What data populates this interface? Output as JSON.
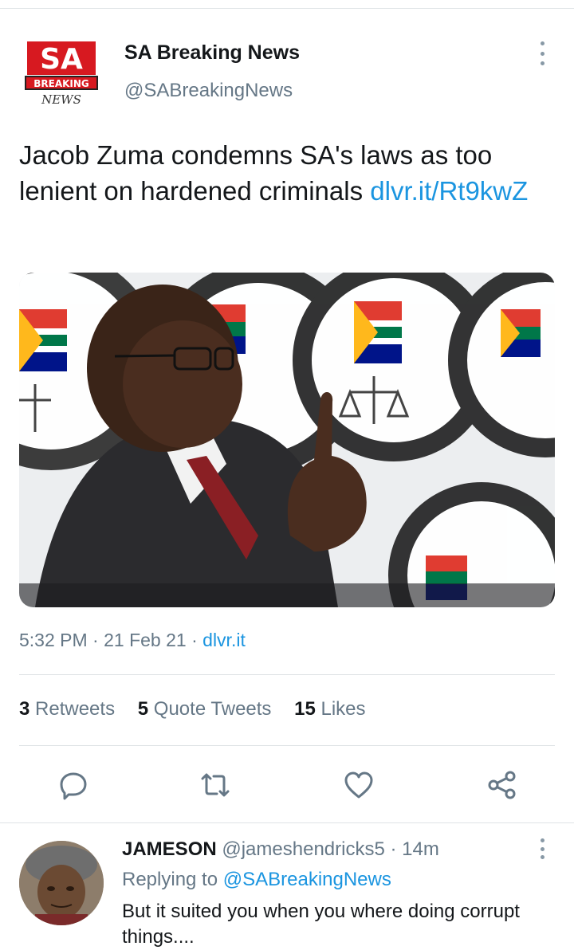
{
  "tweet": {
    "author_name": "SA Breaking News",
    "author_handle": "@SABreakingNews",
    "logo_text_top": "SA",
    "logo_text_mid": "BREAKING",
    "logo_text_bottom": "NEWS",
    "text": "Jacob Zuma condemns SA's laws as too lenient on hardened criminals ",
    "link": "dlvr.it/Rt9kwZ",
    "time": "5:32 PM",
    "date": "21 Feb 21",
    "source": "dlvr.it",
    "retweets_count": "3",
    "retweets_label": "Retweets",
    "quotes_count": "5",
    "quotes_label": "Quote Tweets",
    "likes_count": "15",
    "likes_label": "Likes"
  },
  "actions": [
    "reply-icon",
    "retweet-icon",
    "like-icon",
    "share-icon"
  ],
  "reply": {
    "author_name": "JAMESON",
    "author_handle": "@jameshendricks5",
    "time": "14m",
    "replying_prefix": "Replying to ",
    "replying_to": "@SABreakingNews",
    "text": "But it suited you when you where doing corrupt things...."
  },
  "colors": {
    "link": "#1b95e0",
    "secondary_text": "#657786",
    "brand_red": "#d71920"
  }
}
